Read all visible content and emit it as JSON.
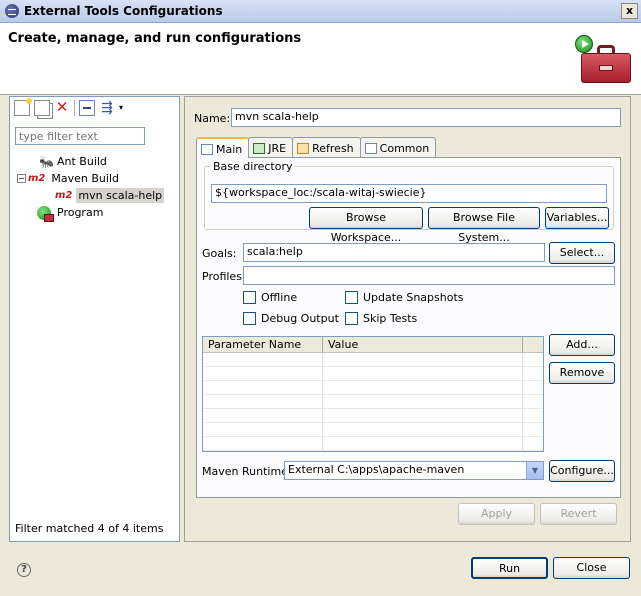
{
  "window": {
    "title": "External Tools Configurations",
    "close_label": "x"
  },
  "header": {
    "title": "Create, manage, and run configurations"
  },
  "left": {
    "toolbar": {
      "dropdown_glyph": "▾"
    },
    "filter_placeholder": "type filter text",
    "tree": [
      {
        "label": "Ant Build",
        "icon": "ant-icon",
        "level": 1
      },
      {
        "label": "Maven Build",
        "icon": "m2-icon",
        "icon_text": "m2",
        "level": 1,
        "expanded": true
      },
      {
        "label": "mvn scala-help",
        "icon": "m2-icon",
        "icon_text": "m2",
        "level": 2,
        "selected": true
      },
      {
        "label": "Program",
        "icon": "program-icon",
        "level": 1
      }
    ],
    "filter_status": "Filter matched 4 of 4 items"
  },
  "right": {
    "name_label": "Name:",
    "name_value": "mvn scala-help",
    "tabs": [
      {
        "label": "Main",
        "active": true
      },
      {
        "label": "JRE"
      },
      {
        "label": "Refresh"
      },
      {
        "label": "Common"
      }
    ],
    "base_directory": {
      "title": "Base directory",
      "value": "${workspace_loc:/scala-witaj-swiecie}",
      "browse_workspace": "Browse Workspace...",
      "browse_fs": "Browse File System...",
      "variables": "Variables..."
    },
    "goals_label": "Goals:",
    "goals_value": "scala:help",
    "goals_select": "Select...",
    "profiles_label": "Profiles:",
    "profiles_value": "",
    "checkboxes": {
      "offline": "Offline",
      "update_snapshots": "Update Snapshots",
      "debug_output": "Debug Output",
      "skip_tests": "Skip Tests"
    },
    "params": {
      "headers": [
        "Parameter Name",
        "Value"
      ],
      "add": "Add...",
      "remove": "Remove"
    },
    "runtime_label": "Maven Runtime:",
    "runtime_value": "External C:\\apps\\apache-maven",
    "configure": "Configure...",
    "apply": "Apply",
    "revert": "Revert"
  },
  "footer": {
    "help_glyph": "?",
    "run": "Run",
    "close": "Close"
  }
}
